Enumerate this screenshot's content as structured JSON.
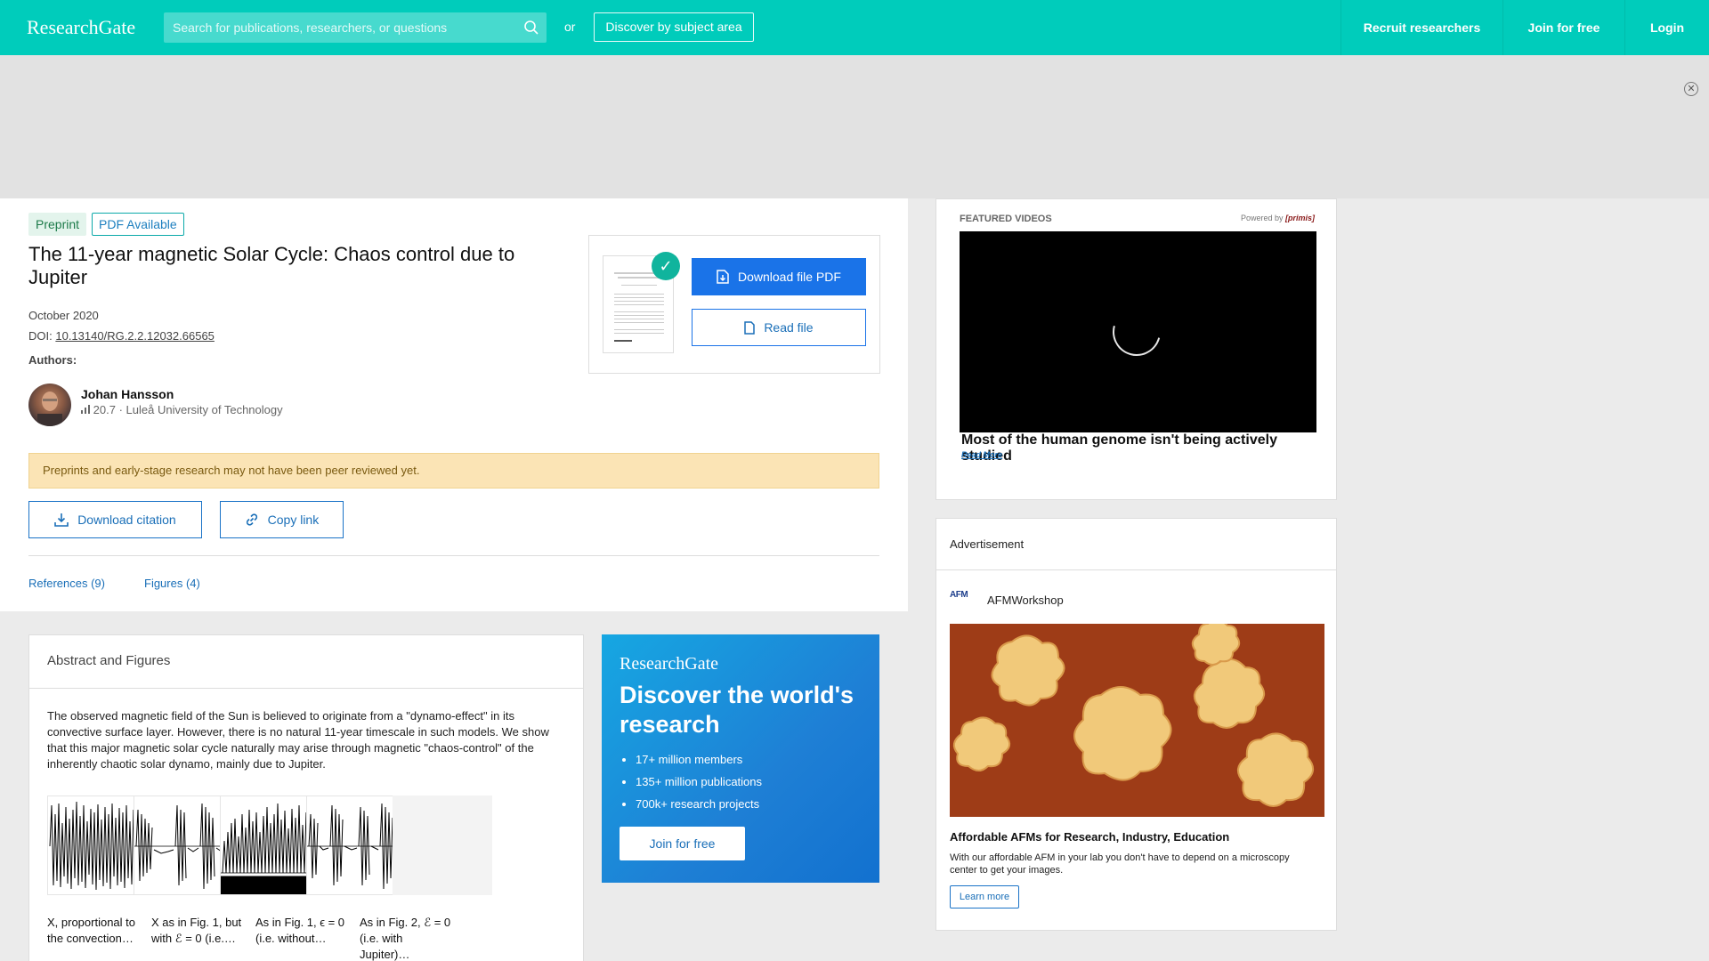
{
  "header": {
    "logo": "ResearchGate",
    "search_placeholder": "Search for publications, researchers, or questions",
    "or_label": "or",
    "discover_label": "Discover by subject area",
    "recruit_label": "Recruit researchers",
    "join_label": "Join for free",
    "login_label": "Login"
  },
  "ad_strip": {
    "close_icon": "close-circle-icon"
  },
  "publication": {
    "badges": [
      "Preprint",
      "PDF Available"
    ],
    "title": "The 11-year magnetic Solar Cycle: Chaos control due to Jupiter",
    "date": "October 2020",
    "doi_label": "DOI:",
    "doi": "10.13140/RG.2.2.12032.66565",
    "authors_label": "Authors:",
    "author": {
      "name": "Johan Hansson",
      "score": "20.7",
      "separator": "·",
      "affiliation": "Luleå University of Technology"
    },
    "warning": "Preprints and early-stage research may not have been peer reviewed yet.",
    "download_citation": "Download citation",
    "copy_link": "Copy link",
    "tabs": [
      "References (9)",
      "Figures (4)"
    ],
    "download_pdf": "Download file PDF",
    "read_file": "Read file"
  },
  "abstract": {
    "heading": "Abstract and Figures",
    "text": "The observed magnetic field of the Sun is believed to originate from a \"dynamo-effect\" in its convective surface layer. However, there is no natural 11-year timescale in such models. We show that this major magnetic solar cycle naturally may arise through magnetic \"chaos-control\" of the inherently chaotic solar dynamo, mainly due to Jupiter.",
    "figures": [
      {
        "caption": "X, proportional to the convection…"
      },
      {
        "caption": "X as in Fig. 1, but with ℰ = 0 (i.e.…"
      },
      {
        "caption": "As in Fig. 1, ϵ = 0 (i.e. without…"
      },
      {
        "caption": "As in Fig. 2, ℰ = 0 (i.e. with Jupiter)…"
      }
    ]
  },
  "promo": {
    "logo": "ResearchGate",
    "title": "Discover the world's research",
    "items": [
      "17+ million members",
      "135+ million publications",
      "700k+ research projects"
    ],
    "button": "Join for free"
  },
  "video": {
    "label": "FEATURED VIDEOS",
    "powered_by": "Powered by",
    "powered_brand": "[primis]",
    "title": "Most of the human genome isn't being actively studied",
    "read_more": "Read More"
  },
  "advert": {
    "label": "Advertisement",
    "logo_text": "AFM",
    "brand": "AFMWorkshop",
    "title": "Affordable AFMs for Research, Industry, Education",
    "description": "With our affordable AFM in your lab you don't have to depend on a microscopy center to get your images.",
    "button": "Learn more"
  },
  "colors": {
    "brand_teal": "#00ccbb",
    "link_blue": "#1a6fb8",
    "primary_blue": "#1a73e8",
    "warning_bg": "#fbe4b5"
  }
}
